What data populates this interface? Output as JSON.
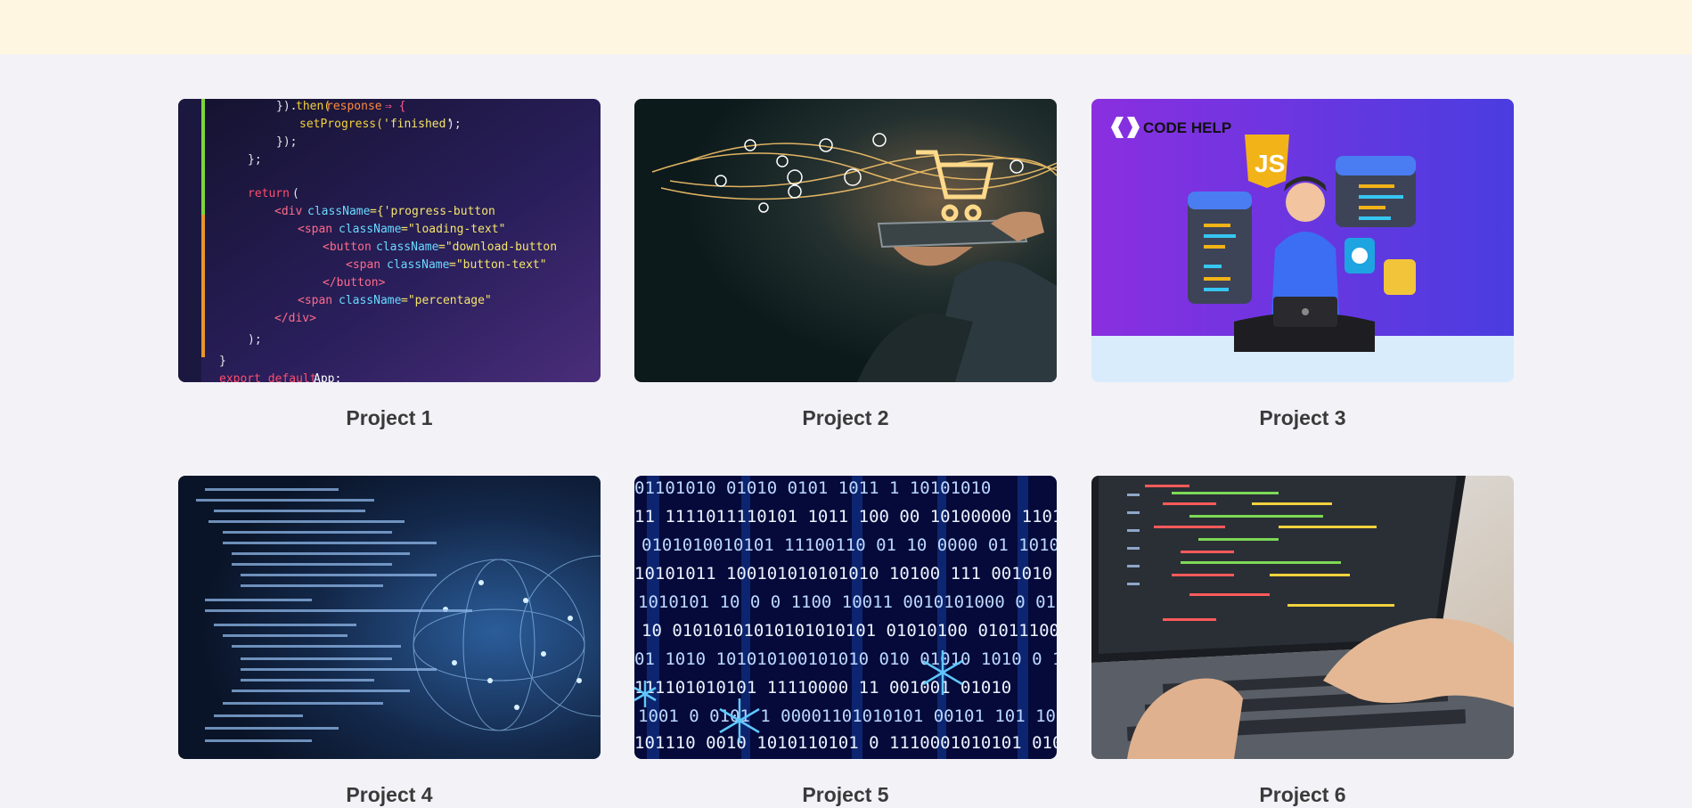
{
  "header": {},
  "projects": [
    {
      "title": "Project 1",
      "image_icon": "code-editor-image"
    },
    {
      "title": "Project 2",
      "image_icon": "ecommerce-tablet-image"
    },
    {
      "title": "Project 3",
      "image_icon": "codehelp-js-image",
      "image_text": {
        "brand": "CODE HELP",
        "badge": "JS"
      }
    },
    {
      "title": "Project 4",
      "image_icon": "data-globe-image"
    },
    {
      "title": "Project 5",
      "image_icon": "binary-matrix-image"
    },
    {
      "title": "Project 6",
      "image_icon": "laptop-typing-image"
    }
  ],
  "colors": {
    "header_bg": "#fff6e1",
    "page_bg": "#f3f2f7",
    "title_text": "#3a3a3a"
  }
}
